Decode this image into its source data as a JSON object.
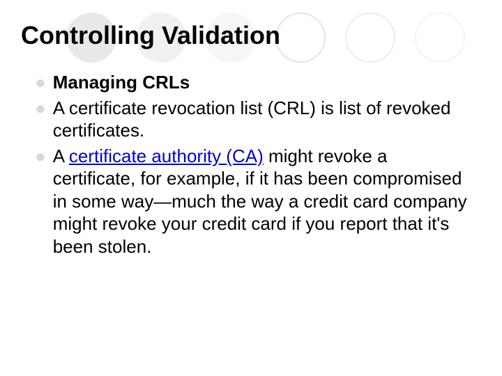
{
  "title": "Controlling Validation",
  "bullets": [
    {
      "prefix_bold": "Managing CRLs",
      "rest": ""
    },
    {
      "prefix_bold": "",
      "rest": "A certificate revocation list (CRL) is list of revoked certificates."
    },
    {
      "prefix_bold": "",
      "before_link": "A ",
      "link_text": "certificate authority (CA)",
      "after_link": " might revoke a certificate, for example, if it has been compromised in some way—much the way a credit card company might revoke your credit card if you report that it's been stolen."
    }
  ]
}
